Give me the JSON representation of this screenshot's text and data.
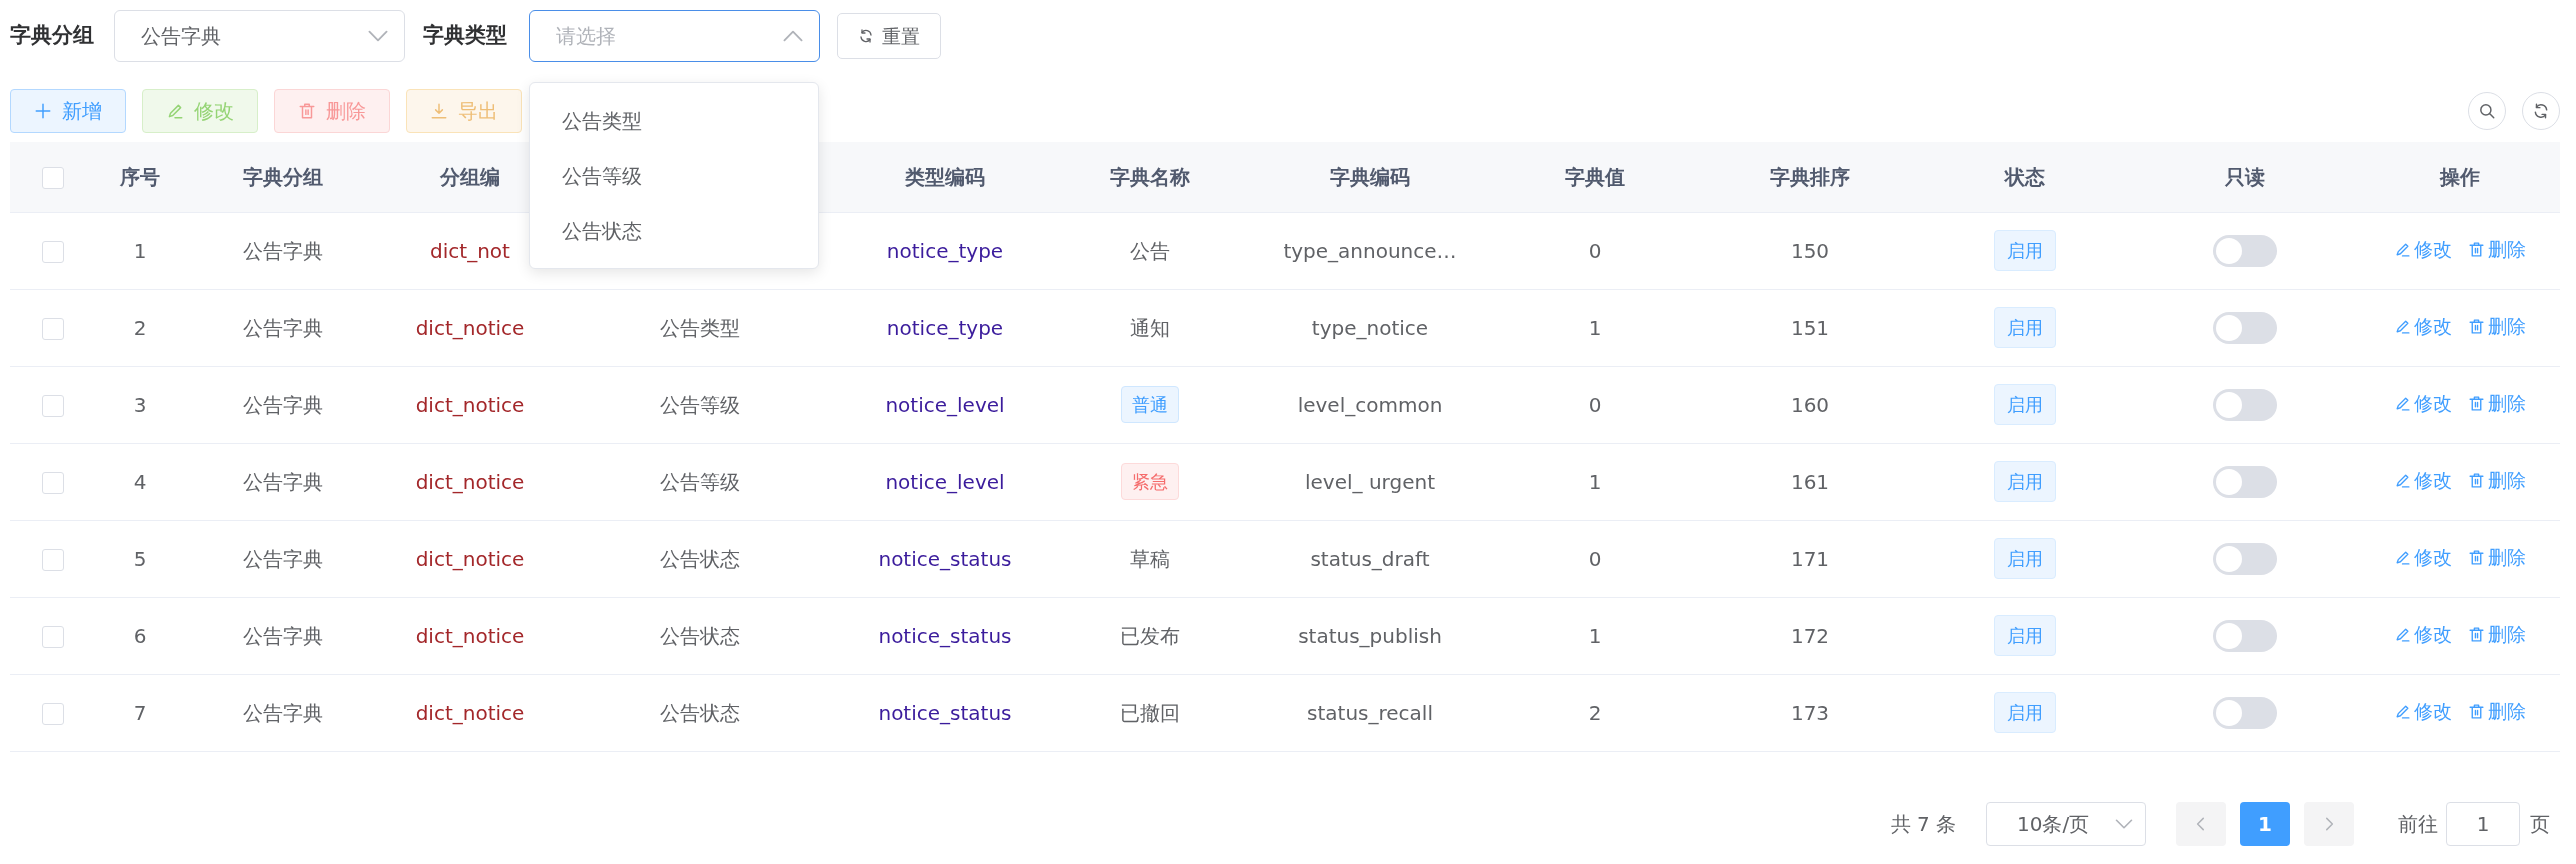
{
  "filters": [
    {
      "label": "字典分组",
      "value": "公告字典",
      "open": false
    },
    {
      "label": "字典类型",
      "placeholder": "请选择",
      "open": true,
      "options": [
        "公告类型",
        "公告等级",
        "公告状态"
      ]
    }
  ],
  "reset_button": "重置",
  "toolbar": [
    {
      "label": "新增",
      "kind": "add"
    },
    {
      "label": "修改",
      "kind": "edit"
    },
    {
      "label": "删除",
      "kind": "delete"
    },
    {
      "label": "导出",
      "kind": "export"
    }
  ],
  "table": {
    "select_all": {
      "checked": false
    },
    "columns": [
      "序号",
      "字典分组",
      "分组编",
      null,
      "类型编码",
      "字典名称",
      "字典编码",
      "字典值",
      "字典排序",
      "状态",
      "只读",
      "操作"
    ],
    "rows": [
      {
        "checked": false,
        "index": "1",
        "group": "公告字典",
        "group_code": "dict_not",
        "type_code": "notice_type",
        "name": "公告",
        "code": "type_announce…",
        "value": "0",
        "sort": "150",
        "status": "启用",
        "readonly": {
          "on": false
        },
        "actions": [
          "修改",
          "删除"
        ]
      },
      {
        "checked": false,
        "index": "2",
        "group": "公告字典",
        "group_code": "dict_notice",
        "type_name": "公告类型",
        "type_code": "notice_type",
        "name": "通知",
        "code": "type_notice",
        "value": "1",
        "sort": "151",
        "status": "启用",
        "readonly": {
          "on": false
        },
        "actions": [
          "修改",
          "删除"
        ]
      },
      {
        "checked": false,
        "index": "3",
        "group": "公告字典",
        "group_code": "dict_notice",
        "type_name": "公告等级",
        "type_code": "notice_level",
        "name": "普通",
        "color": "#409eff",
        "code": "level_common",
        "value": "0",
        "sort": "160",
        "status": "启用",
        "readonly": {
          "on": false
        },
        "actions": [
          "修改",
          "删除"
        ]
      },
      {
        "checked": false,
        "index": "4",
        "group": "公告字典",
        "group_code": "dict_notice",
        "type_name": "公告等级",
        "type_code": "notice_level",
        "name": "紧急",
        "color": "#f56c6c",
        "code": "level_ urgent",
        "value": "1",
        "sort": "161",
        "status": "启用",
        "readonly": {
          "on": false
        },
        "actions": [
          "修改",
          "删除"
        ]
      },
      {
        "checked": false,
        "index": "5",
        "group": "公告字典",
        "group_code": "dict_notice",
        "type_name": "公告状态",
        "type_code": "notice_status",
        "name": "草稿",
        "code": "status_draft",
        "value": "0",
        "sort": "171",
        "status": "启用",
        "readonly": {
          "on": false
        },
        "actions": [
          "修改",
          "删除"
        ]
      },
      {
        "checked": false,
        "index": "6",
        "group": "公告字典",
        "group_code": "dict_notice",
        "type_name": "公告状态",
        "type_code": "notice_status",
        "name": "已发布",
        "code": "status_publish",
        "value": "1",
        "sort": "172",
        "status": "启用",
        "readonly": {
          "on": false
        },
        "actions": [
          "修改",
          "删除"
        ]
      },
      {
        "checked": false,
        "index": "7",
        "group": "公告字典",
        "group_code": "dict_notice",
        "type_name": "公告状态",
        "type_code": "notice_status",
        "name": "已撤回",
        "code": "status_recall",
        "value": "2",
        "sort": "173",
        "status": "启用",
        "readonly": {
          "on": false
        },
        "actions": [
          "修改",
          "删除"
        ]
      }
    ]
  },
  "pagination": {
    "total": "共 7 条",
    "page_size": "10条/页",
    "pages": [
      {
        "label": "1",
        "selected": true
      }
    ],
    "goto_label": "前往",
    "goto_value": "1",
    "goto_suffix": "页"
  }
}
